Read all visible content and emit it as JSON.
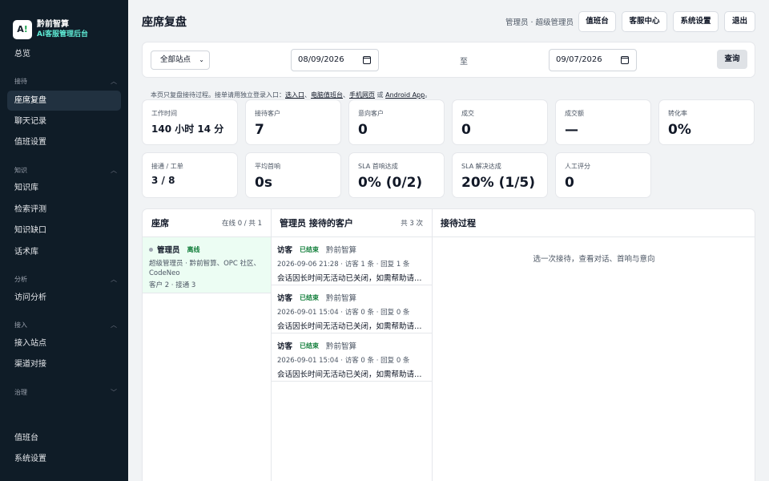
{
  "brand": {
    "logo": "A!",
    "name": "黔前智算",
    "subtitle": "Ai客服管理后台"
  },
  "sidebar": {
    "top_items": [
      {
        "label": "总览"
      }
    ],
    "sections": [
      {
        "title": "接待",
        "items": [
          {
            "label": "座席复盘",
            "active": true
          },
          {
            "label": "聊天记录"
          },
          {
            "label": "值班设置"
          }
        ]
      },
      {
        "title": "知识",
        "items": [
          {
            "label": "知识库"
          },
          {
            "label": "检索评测"
          },
          {
            "label": "知识缺口"
          },
          {
            "label": "话术库"
          }
        ]
      },
      {
        "title": "分析",
        "items": [
          {
            "label": "访问分析"
          }
        ]
      },
      {
        "title": "接入",
        "items": [
          {
            "label": "接入站点"
          },
          {
            "label": "渠道对接"
          }
        ]
      },
      {
        "title": "治理",
        "items": []
      }
    ],
    "bottom_items": [
      {
        "label": "值班台"
      },
      {
        "label": "系统设置"
      }
    ]
  },
  "header": {
    "title": "座席复盘",
    "user": "管理员 · 超级管理员",
    "buttons": [
      "值班台",
      "客服中心",
      "系统设置",
      "退出"
    ]
  },
  "filters": {
    "site_select": "全部站点",
    "date_from": "08/09/2026",
    "to_label": "至",
    "date_to": "09/07/2026",
    "query_label": "查询"
  },
  "notice": {
    "prefix": "本页只复盘接待过程。接单请用独立登录入口：",
    "links": [
      "选入口",
      "电脑值班台",
      "手机网页",
      "Android App"
    ],
    "sep1": "、",
    "sep2": "、",
    "sep3": " 或 ",
    "suffix": "。"
  },
  "stats_row1": [
    {
      "label": "工作时间",
      "value": "140 小时 14 分"
    },
    {
      "label": "接待客户",
      "value": "7"
    },
    {
      "label": "意向客户",
      "value": "0"
    },
    {
      "label": "成交",
      "value": "0"
    },
    {
      "label": "成交额",
      "value": "—"
    },
    {
      "label": "转化率",
      "value": "0%"
    }
  ],
  "stats_row2": [
    {
      "label": "接通 / 工单",
      "value": "3 / 8"
    },
    {
      "label": "平均首响",
      "value": "0s"
    },
    {
      "label": "SLA 首响达成",
      "value": "0% (0/2)"
    },
    {
      "label": "SLA 解决达成",
      "value": "20% (1/5)"
    },
    {
      "label": "人工评分",
      "value": "0"
    }
  ],
  "agents_panel": {
    "title": "座席",
    "meta": "在线 0 / 共 1",
    "agents": [
      {
        "name": "管理员",
        "status": "离线",
        "desc": "超级管理员 · 黔前智算、OPC 社区、CodeNeo",
        "stats": "客户 2 · 接通 3"
      }
    ]
  },
  "conversations_panel": {
    "title": "管理员 接待的客户",
    "meta": "共 3 次",
    "items": [
      {
        "visitor": "访客",
        "status": "已结束",
        "agent": "黔前智算",
        "meta": "2026-09-06 21:28 · 访客 1 条 · 回复 1 条",
        "message": "会话因长时间无活动已关闭，如需帮助请重新发起会话"
      },
      {
        "visitor": "访客",
        "status": "已结束",
        "agent": "黔前智算",
        "meta": "2026-09-01 15:04 · 访客 0 条 · 回复 0 条",
        "message": "会话因长时间无活动已关闭，如需帮助请重新发起会话"
      },
      {
        "visitor": "访客",
        "status": "已结束",
        "agent": "黔前智算",
        "meta": "2026-09-01 15:04 · 访客 0 条 · 回复 0 条",
        "message": "会话因长时间无活动已关闭，如需帮助请重新发起会话"
      }
    ]
  },
  "process_panel": {
    "title": "接待过程",
    "hint": "选一次接待，查看对话、首响与意向"
  }
}
